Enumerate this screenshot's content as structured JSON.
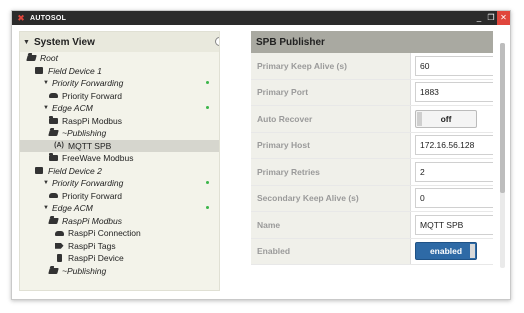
{
  "window": {
    "title": "AUTOSOL",
    "logo_icon": "autosol-logo-icon",
    "controls": [
      "minimize",
      "restore",
      "close"
    ],
    "minimize_glyph": "_",
    "restore_glyph": "❐",
    "close_glyph": "✕"
  },
  "tree": {
    "title": "System View",
    "nodes": [
      {
        "label": "Root",
        "italic": true,
        "indent": 0,
        "icon": "folder-open-icon",
        "dot": false
      },
      {
        "label": "Field Device 1",
        "italic": true,
        "indent": 1,
        "icon": "chip-icon",
        "dot": false
      },
      {
        "label": "Priority Forwarding",
        "italic": true,
        "indent": 2,
        "icon": "caret-down-icon",
        "dot": true
      },
      {
        "label": "Priority Forward",
        "italic": false,
        "indent": 3,
        "icon": "car-icon",
        "dot": false
      },
      {
        "label": "Edge ACM",
        "italic": true,
        "indent": 2,
        "icon": "caret-down-icon",
        "dot": true
      },
      {
        "label": "RaspPi Modbus",
        "italic": false,
        "indent": 3,
        "icon": "folder-icon",
        "dot": false
      },
      {
        "label": "~Publishing",
        "italic": true,
        "indent": 3,
        "icon": "folder-open-icon",
        "dot": false
      },
      {
        "label": "MQTT SPB",
        "italic": false,
        "indent": 4,
        "icon": "antenna-icon",
        "dot": false,
        "selected": true
      },
      {
        "label": "FreeWave Modbus",
        "italic": false,
        "indent": 3,
        "icon": "folder-icon",
        "dot": false
      },
      {
        "label": "Field Device 2",
        "italic": true,
        "indent": 1,
        "icon": "chip-icon",
        "dot": false
      },
      {
        "label": "Priority Forwarding",
        "italic": true,
        "indent": 2,
        "icon": "caret-down-icon",
        "dot": true
      },
      {
        "label": "Priority Forward",
        "italic": false,
        "indent": 3,
        "icon": "car-icon",
        "dot": false
      },
      {
        "label": "Edge ACM",
        "italic": true,
        "indent": 2,
        "icon": "caret-down-icon",
        "dot": true
      },
      {
        "label": "RaspPi Modbus",
        "italic": true,
        "indent": 3,
        "icon": "folder-open-icon",
        "dot": false
      },
      {
        "label": "RaspPi Connection",
        "italic": false,
        "indent": 4,
        "icon": "car-icon",
        "dot": false
      },
      {
        "label": "RaspPi Tags",
        "italic": false,
        "indent": 4,
        "icon": "tag-icon",
        "dot": false
      },
      {
        "label": "RaspPi Device",
        "italic": false,
        "indent": 4,
        "icon": "phone-icon",
        "dot": false
      },
      {
        "label": "~Publishing",
        "italic": true,
        "indent": 3,
        "icon": "folder-open-icon",
        "dot": false
      }
    ]
  },
  "props": {
    "title": "SPB Publisher",
    "rows": [
      {
        "label": "Primary Keep Alive (s)",
        "type": "text",
        "value": "60"
      },
      {
        "label": "Primary Port",
        "type": "text",
        "value": "1883"
      },
      {
        "label": "Auto Recover",
        "type": "toggle-off",
        "value": "off"
      },
      {
        "label": "Primary Host",
        "type": "text",
        "value": "172.16.56.128"
      },
      {
        "label": "Primary Retries",
        "type": "text",
        "value": "2"
      },
      {
        "label": "Secondary Keep Alive (s)",
        "type": "text",
        "value": "0"
      },
      {
        "label": "Name",
        "type": "text",
        "value": "MQTT SPB"
      },
      {
        "label": "Enabled",
        "type": "toggle-on",
        "value": "enabled"
      }
    ]
  },
  "colors": {
    "accent": "#2e6aa6",
    "status_dot": "#3bb54a",
    "close_button": "#e0463c",
    "titlebar": "#2b2b2b"
  }
}
